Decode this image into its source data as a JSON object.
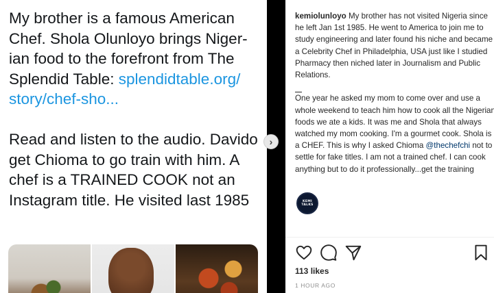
{
  "tweet": {
    "paragraph1_text": "My brother is a famous American Chef. Shola Olunloyo brings Niger-ian food to the forefront from The Splendid Table: ",
    "paragraph1_link": "splendidtable.org/ story/chef-sho...",
    "paragraph2_text": "Read and listen to the audio. Davido get Chioma to go train with him. A chef is a TRAINED COOK not an Instagram title. He visited last 1985"
  },
  "media": {
    "items": [
      "food-plate-photo",
      "chef-portrait-photo",
      "food-dish-photo"
    ]
  },
  "carousel": {
    "next_glyph": "›"
  },
  "instagram": {
    "username": "kemiolunloyo",
    "caption_part1": " My brother has not visited Nigeria since he left Jan 1st 1985. He went to America to join me to study engineering and later found his niche and became a Celebrity Chef in Philadelphia, USA just like I studied Pharmacy then niched later in Journalism and Public Relations.",
    "caption_part2": "One year he asked my mom to come over and use a whole weekend to teach him how to cook all the Nigerian foods we ate a kids. It was me and Shola that always watched my mom cooking. I'm a gourmet cook. Shola is a CHEF. This is why I asked Chioma ",
    "caption_mention": "@thechefchi",
    "caption_part3": " not to settle for fake titles. I am not a trained chef. I can cook anything but to do it professionally...get the training",
    "avatar_line1": "KEMI",
    "avatar_line2": "TALKS",
    "likes": "113 likes",
    "time": "1 HOUR AGO"
  },
  "icons": {
    "like": "heart-icon",
    "comment": "comment-icon",
    "share": "share-icon",
    "save": "bookmark-icon"
  }
}
